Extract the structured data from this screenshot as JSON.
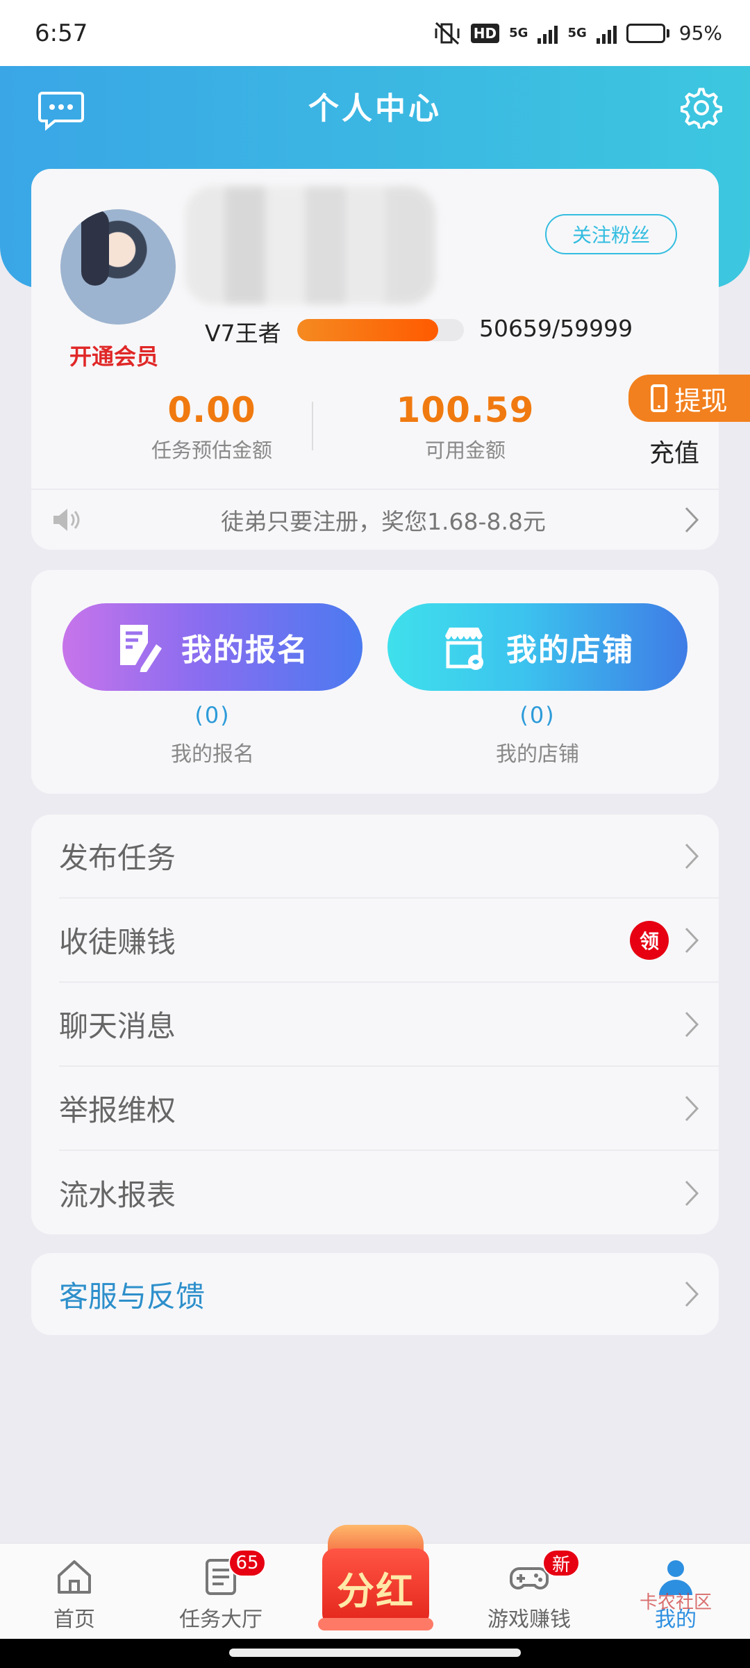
{
  "status_bar": {
    "time": "6:57",
    "hd": "HD",
    "net1": "5G",
    "net2": "5G",
    "battery": "95%"
  },
  "header": {
    "title": "个人中心"
  },
  "profile": {
    "follow_label": "关注粉丝",
    "vip_label": "开通会员",
    "level_label": "V7王者",
    "level_progress": 0.8447,
    "level_value": "50659/59999",
    "estimated_amount": "0.00",
    "estimated_label": "任务预估金额",
    "available_amount": "100.59",
    "available_label": "可用金额",
    "withdraw_label": "提现",
    "recharge_label": "充值",
    "notice": "徒弟只要注册，奖您1.68-8.8元"
  },
  "actions": {
    "signup": {
      "button_label": "我的报名",
      "count": "(0)",
      "label": "我的报名"
    },
    "shop": {
      "button_label": "我的店铺",
      "count": "(0)",
      "label": "我的店铺"
    }
  },
  "menu": {
    "items": [
      {
        "label": "发布任务"
      },
      {
        "label": "收徒赚钱",
        "badge": "领"
      },
      {
        "label": "聊天消息"
      },
      {
        "label": "举报维权"
      },
      {
        "label": "流水报表"
      }
    ]
  },
  "service": {
    "label": "客服与反馈"
  },
  "bottom_nav": {
    "home": "首页",
    "tasks": "任务大厅",
    "tasks_badge": "65",
    "center": "分红",
    "games": "游戏赚钱",
    "games_badge": "新",
    "me": "我的"
  },
  "watermark": "卡农社区",
  "colors": {
    "accent_orange": "#f07a10",
    "header_blue": "#3aa6e6",
    "link_blue": "#2d8fcb",
    "badge_red": "#e60012"
  }
}
